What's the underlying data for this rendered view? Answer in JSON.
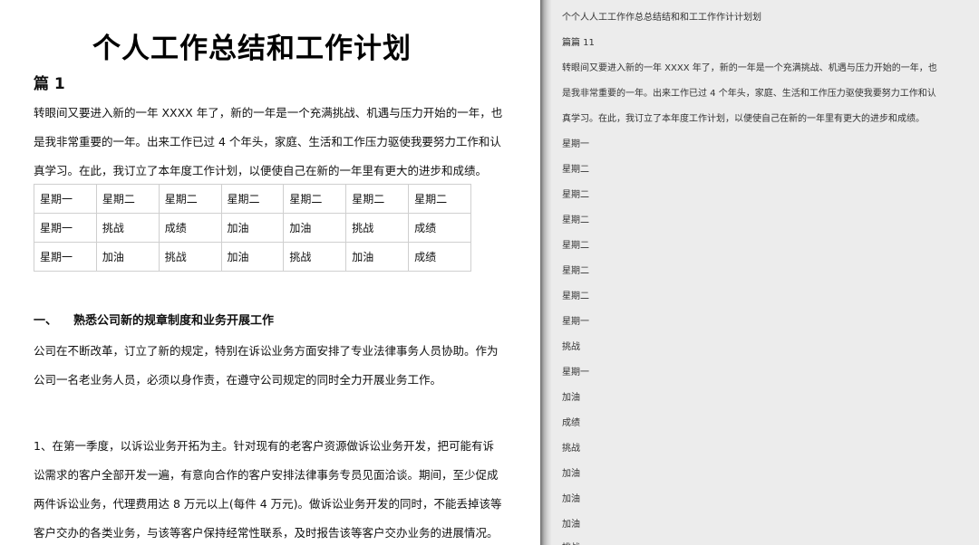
{
  "document": {
    "title": "个人工作总结和工作计划",
    "section_heading": "篇 1",
    "intro_lines": [
      "转眼间又要进入新的一年 XXXX 年了，新的一年是一个充满挑战、机遇与压力开始的一年，也",
      "是我非常重要的一年。出来工作已过 4 个年头，家庭、生活和工作压力驱使我要努力工作和认",
      "真学习。在此，我订立了本年度工作计划，以便使自己在新的一年里有更大的进步和成绩。"
    ],
    "table": [
      [
        "星期一",
        "星期二",
        "星期二",
        "星期二",
        "星期二",
        "星期二",
        "星期二"
      ],
      [
        "星期一",
        "挑战",
        "成绩",
        "加油",
        "加油",
        "挑战",
        "成绩"
      ],
      [
        "星期一",
        "加油",
        "挑战",
        "加油",
        "挑战",
        "加油",
        "成绩"
      ]
    ],
    "sub_heading_num": "一、",
    "sub_heading_text": "熟悉公司新的规章制度和业务开展工作",
    "para2_lines": [
      "公司在不断改革，订立了新的规定，特别在诉讼业务方面安排了专业法律事务人员协助。作为",
      "公司一名老业务人员，必须以身作责，在遵守公司规定的同时全力开展业务工作。"
    ],
    "para3_lines": [
      "1、在第一季度，以诉讼业务开拓为主。针对现有的老客户资源做诉讼业务开发，把可能有诉",
      "讼需求的客户全部开发一遍，有意向合作的客户安排法律事务专员见面洽谈。期间，至少促成",
      "两件诉讼业务，代理费用达 8 万元以上(每件 4 万元)。做诉讼业务开发的同时，不能丢掉该等",
      "客户交办的各类业务，与该等客户保持经常性联系，及时报告该等客户交办业务的进展情况。"
    ]
  },
  "extracted_panel": {
    "lines": [
      "个个人人工工作作总总结结和和工工作作计计划划",
      "篇篇 11",
      "转眼间又要进入新的一年 XXXX 年了，新的一年是一个充满挑战、机遇与压力开始的一年，也",
      "是我非常重要的一年。出来工作已过 4 个年头，家庭、生活和工作压力驱使我要努力工作和认",
      "真学习。在此，我订立了本年度工作计划，以便使自己在新的一年里有更大的进步和成绩。",
      "星期一",
      "星期二",
      "星期二",
      "星期二",
      "星期二",
      "星期二",
      "星期二",
      "星期一",
      "挑战",
      "星期一",
      "加油",
      "成绩",
      "挑战",
      "加油",
      "加油",
      "加油",
      "挑战"
    ]
  }
}
